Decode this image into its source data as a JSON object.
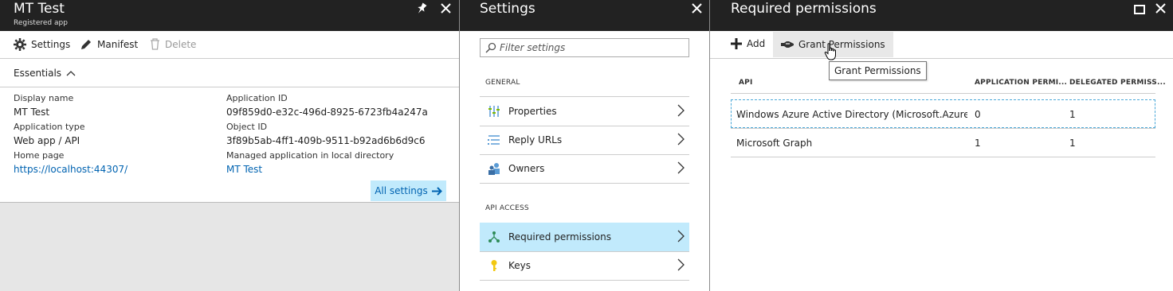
{
  "app_blade": {
    "title": "MT Test",
    "subtitle": "Registered app",
    "toolbar": {
      "settings": "Settings",
      "manifest": "Manifest",
      "delete": "Delete"
    },
    "essentials_label": "Essentials",
    "fields": {
      "display_name_label": "Display name",
      "display_name": "MT Test",
      "app_type_label": "Application type",
      "app_type": "Web app / API",
      "home_page_label": "Home page",
      "home_page": "https://localhost:44307/",
      "app_id_label": "Application ID",
      "app_id": "09f859d0-e32c-496d-8925-6723fb4a247a",
      "object_id_label": "Object ID",
      "object_id": "3f89b5ab-4ff1-409b-9511-b92ad6b6d9c6",
      "managed_label": "Managed application in local directory",
      "managed": "MT Test"
    },
    "all_settings": "All settings"
  },
  "settings_blade": {
    "title": "Settings",
    "filter_placeholder": "Filter settings",
    "general_label": "GENERAL",
    "general_items": [
      "Properties",
      "Reply URLs",
      "Owners"
    ],
    "api_access_label": "API ACCESS",
    "api_items": [
      "Required permissions",
      "Keys"
    ]
  },
  "permissions_blade": {
    "title": "Required permissions",
    "toolbar": {
      "add": "Add",
      "grant": "Grant Permissions"
    },
    "tooltip": "Grant Permissions",
    "columns": [
      "API",
      "APPLICATION PERMI...",
      "DELEGATED PERMISS..."
    ],
    "rows": [
      [
        "Windows Azure Active Directory (Microsoft.Azure.Ac...",
        "0",
        "1"
      ],
      [
        "Microsoft Graph",
        "1",
        "1"
      ]
    ]
  },
  "colors": {
    "header": "#222222",
    "accent": "#0063b1",
    "selected": "#c1eafc",
    "button": "#c1eafc"
  }
}
